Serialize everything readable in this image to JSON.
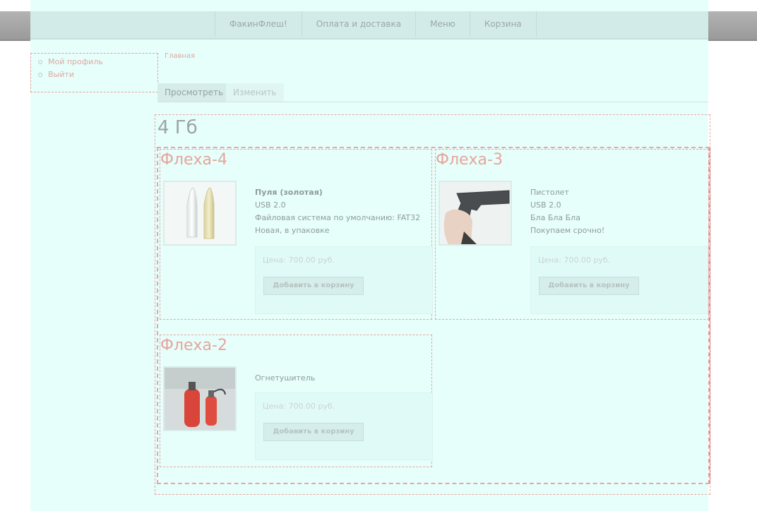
{
  "nav": {
    "items": [
      "ФакинФлеш!",
      "Оплата и доставка",
      "Меню",
      "Корзина"
    ]
  },
  "profile": {
    "links": [
      "Мой профиль",
      "Выйти"
    ]
  },
  "breadcrumb": "Главная",
  "tabs": {
    "view": "Просмотреть",
    "edit": "Изменить"
  },
  "term_title": "4 Гб",
  "products": [
    {
      "title": "Флеха-4",
      "image_icon": "bullets-icon",
      "description": [
        "Пуля (золотая)",
        "USB 2.0",
        "Файловая система по умолчанию: FAT32",
        "Новая, в упаковке"
      ],
      "price": "Цена: 700.00 руб.",
      "button": "Добавить в корзину"
    },
    {
      "title": "Флеха-3",
      "image_icon": "pistol-icon",
      "description": [
        "Пистолет",
        "USB 2.0",
        "Бла Бла Бла",
        "Покупаем срочно!"
      ],
      "price": "Цена: 700.00 руб.",
      "button": "Добавить в корзину"
    },
    {
      "title": "Флеха-2",
      "image_icon": "fire-extinguisher-icon",
      "description": [
        "Огнетушитель"
      ],
      "price": "Цена: 700.00 руб.",
      "button": "Добавить в корзину"
    }
  ],
  "colors": {
    "page_bg": "#e6fffb",
    "nav_bg": "#d3ebe8",
    "title_accent": "#e6a59c",
    "dashed_border": "#e9a5a5"
  }
}
